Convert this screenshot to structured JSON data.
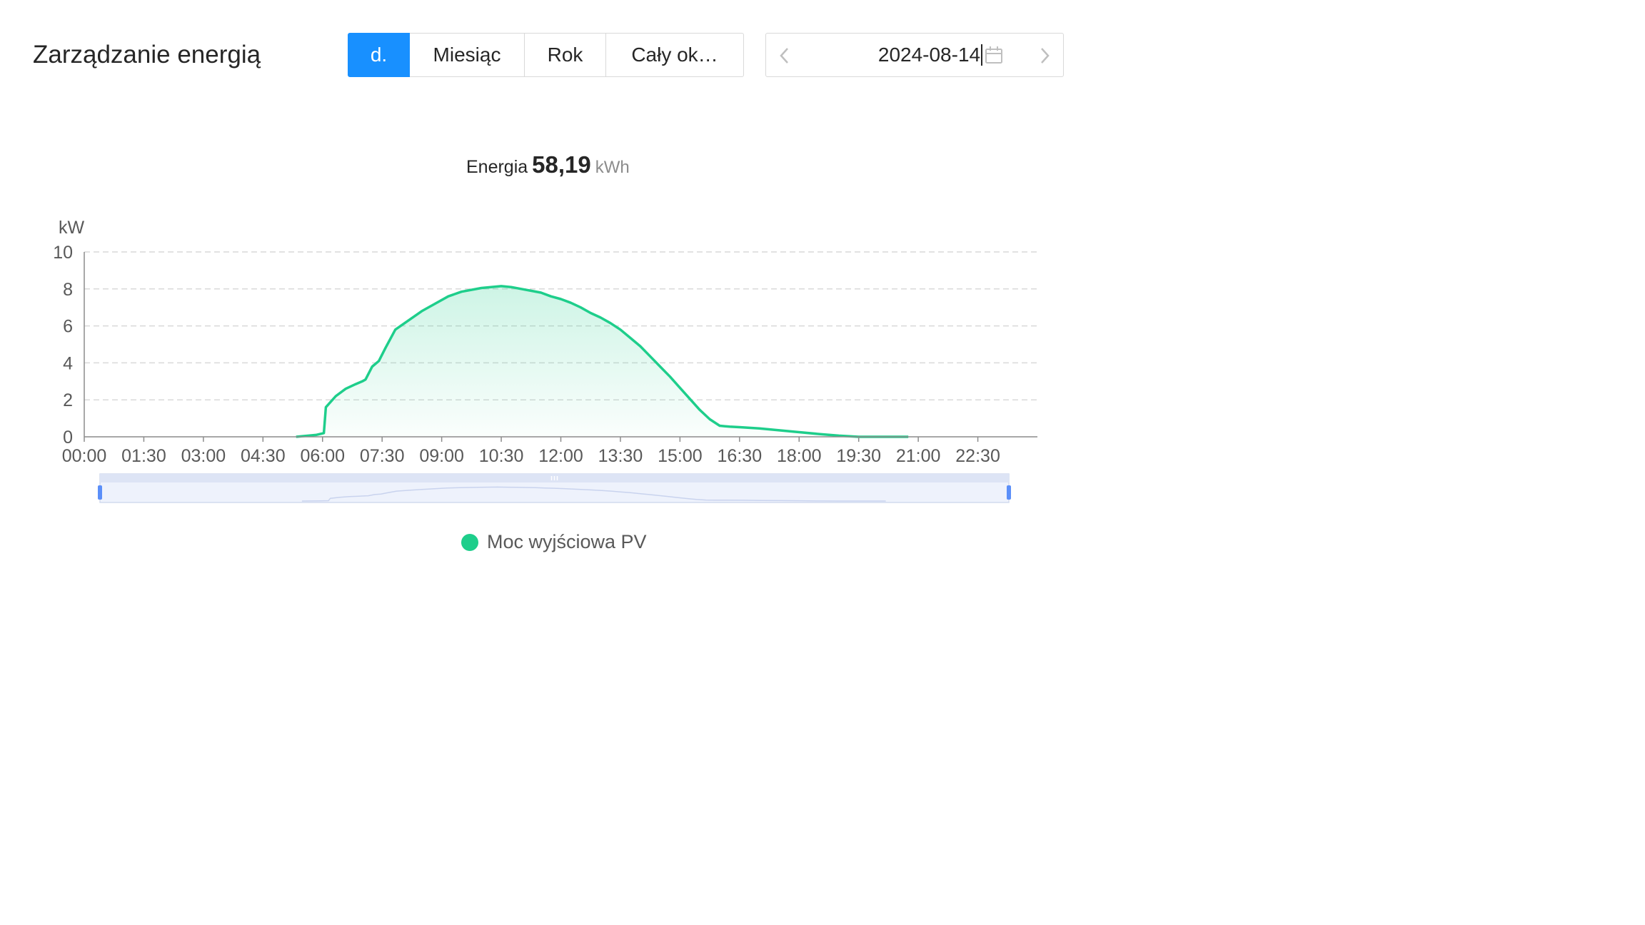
{
  "header": {
    "title": "Zarządzanie energią",
    "tabs": [
      {
        "label": "d.",
        "active": true
      },
      {
        "label": "Miesiąc",
        "active": false
      },
      {
        "label": "Rok",
        "active": false
      },
      {
        "label": "Cały ok…",
        "active": false
      }
    ],
    "date": "2024-08-14",
    "icons": {
      "prev": "chevron-left-icon",
      "next": "chevron-right-icon",
      "calendar": "calendar-icon"
    }
  },
  "summary": {
    "label": "Energia",
    "value": "58,19",
    "unit": "kWh"
  },
  "colors": {
    "accent": "#1890ff",
    "series": "#1ece8b"
  },
  "chart_data": {
    "type": "area",
    "ylabel": "kW",
    "ylim": [
      0,
      10
    ],
    "yticks": [
      "0",
      "2",
      "4",
      "6",
      "8",
      "10"
    ],
    "xlim": [
      "00:00",
      "24:00"
    ],
    "xticks": [
      "00:00",
      "01:30",
      "03:00",
      "04:30",
      "06:00",
      "07:30",
      "09:00",
      "10:30",
      "12:00",
      "13:30",
      "15:00",
      "16:30",
      "18:00",
      "19:30",
      "21:00",
      "22:30"
    ],
    "grid": true,
    "legend_position": "bottom",
    "series": [
      {
        "name": "Moc wyjściowa PV",
        "x": [
          "05:20",
          "05:50",
          "06:02",
          "06:05",
          "06:20",
          "06:35",
          "06:50",
          "07:00",
          "07:05",
          "07:15",
          "07:25",
          "07:35",
          "07:50",
          "08:10",
          "08:30",
          "08:50",
          "09:10",
          "09:30",
          "10:00",
          "10:30",
          "10:45",
          "11:00",
          "11:15",
          "11:30",
          "11:45",
          "12:00",
          "12:15",
          "12:30",
          "12:45",
          "13:00",
          "13:15",
          "13:30",
          "13:45",
          "14:00",
          "14:15",
          "14:30",
          "14:45",
          "15:00",
          "15:15",
          "15:30",
          "15:45",
          "16:00",
          "16:15",
          "16:30",
          "17:00",
          "17:30",
          "18:00",
          "18:30",
          "19:00",
          "19:30",
          "19:45",
          "20:00",
          "20:30",
          "20:45"
        ],
        "y": [
          0.0,
          0.1,
          0.2,
          1.6,
          2.2,
          2.6,
          2.85,
          3.0,
          3.1,
          3.8,
          4.1,
          4.8,
          5.8,
          6.3,
          6.8,
          7.2,
          7.6,
          7.85,
          8.05,
          8.15,
          8.1,
          8.0,
          7.9,
          7.8,
          7.6,
          7.45,
          7.25,
          7.0,
          6.7,
          6.45,
          6.15,
          5.8,
          5.35,
          4.9,
          4.35,
          3.8,
          3.25,
          2.65,
          2.05,
          1.45,
          0.95,
          0.6,
          0.55,
          0.52,
          0.45,
          0.35,
          0.25,
          0.15,
          0.06,
          0.0,
          0.0,
          0.0,
          0.0,
          0.0
        ]
      }
    ]
  }
}
